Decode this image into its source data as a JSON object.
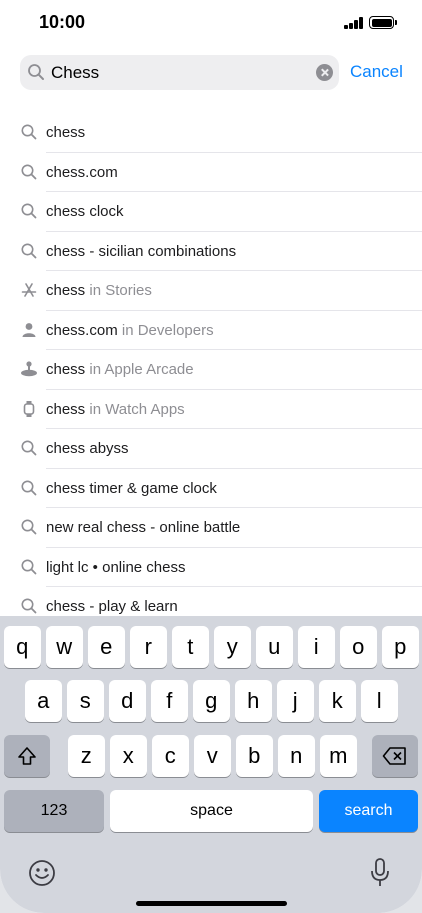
{
  "status_bar": {
    "time": "10:00"
  },
  "search": {
    "value": "Chess",
    "cancel_label": "Cancel"
  },
  "suggestions": [
    {
      "icon": "search-icon",
      "text": "chess",
      "context": ""
    },
    {
      "icon": "search-icon",
      "text": "chess.com",
      "context": ""
    },
    {
      "icon": "search-icon",
      "text": "chess clock",
      "context": ""
    },
    {
      "icon": "search-icon",
      "text": "chess - sicilian combinations",
      "context": ""
    },
    {
      "icon": "app-store-icon",
      "text": "chess",
      "context": " in Stories"
    },
    {
      "icon": "person-icon",
      "text": "chess.com",
      "context": " in Developers"
    },
    {
      "icon": "arcade-icon",
      "text": "chess",
      "context": " in Apple Arcade"
    },
    {
      "icon": "watch-icon",
      "text": "chess",
      "context": " in Watch Apps"
    },
    {
      "icon": "search-icon",
      "text": "chess abyss",
      "context": ""
    },
    {
      "icon": "search-icon",
      "text": "chess timer & game clock",
      "context": ""
    },
    {
      "icon": "search-icon",
      "text": "new real chess - online battle",
      "context": ""
    },
    {
      "icon": "search-icon",
      "text": "light lc • online chess",
      "context": ""
    },
    {
      "icon": "search-icon",
      "text": "chess - play & learn",
      "context": ""
    }
  ],
  "keyboard": {
    "row1": [
      "q",
      "w",
      "e",
      "r",
      "t",
      "y",
      "u",
      "i",
      "o",
      "p"
    ],
    "row2": [
      "a",
      "s",
      "d",
      "f",
      "g",
      "h",
      "j",
      "k",
      "l"
    ],
    "row3": [
      "z",
      "x",
      "c",
      "v",
      "b",
      "n",
      "m"
    ],
    "numbers_label": "123",
    "space_label": "space",
    "search_label": "search"
  },
  "colors": {
    "accent": "#0a84ff",
    "keyboard_bg": "#d3d6dd",
    "secondary_text": "#8e8e93"
  }
}
